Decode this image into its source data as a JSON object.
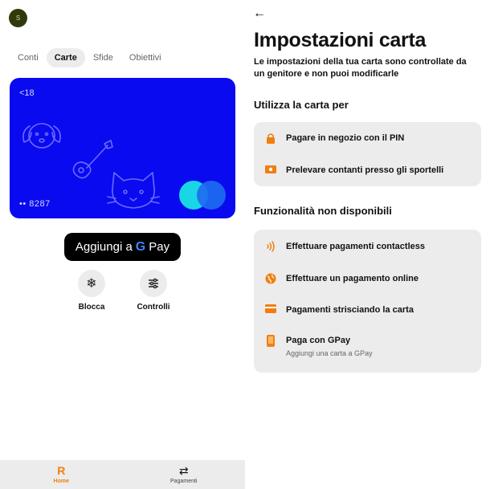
{
  "left": {
    "avatar_initial": "S",
    "tabs": [
      {
        "label": "Conti"
      },
      {
        "label": "Carte"
      },
      {
        "label": "Sfide"
      },
      {
        "label": "Obiettivi"
      }
    ],
    "card": {
      "age_badge": "<18",
      "card_number": "•• 8287"
    },
    "gpay": {
      "prefix": "Aggiungi a",
      "g": "G",
      "pay": "Pay"
    },
    "actions": [
      {
        "label": "Blocca",
        "icon": "snowflake-icon"
      },
      {
        "label": "Controlli",
        "icon": "sliders-icon"
      }
    ],
    "nav": [
      {
        "label": "Home",
        "icon": "R"
      },
      {
        "label": "Pagamenti",
        "icon": "⇄"
      }
    ],
    "accent": "#f07f10",
    "card_color": "#0a0af0"
  },
  "right": {
    "title": "Impostazioni carta",
    "subtitle": "Le impostazioni della tua carta sono controllate da un genitore e non puoi modificarle",
    "section1": "Utilizza la carta per",
    "section1_items": [
      {
        "label": "Pagare in negozio con il PIN",
        "icon": "lock-icon"
      },
      {
        "label": "Prelevare contanti presso gli sportelli",
        "icon": "cash-icon"
      }
    ],
    "section2": "Funzionalità non disponibili",
    "section2_items": [
      {
        "label": "Effettuare pagamenti contactless",
        "icon": "contactless-icon"
      },
      {
        "label": "Effettuare un pagamento online",
        "icon": "globe-icon"
      },
      {
        "label": "Pagamenti strisciando la carta",
        "icon": "card-icon"
      },
      {
        "label": "Paga con GPay",
        "icon": "phone-icon",
        "sub": "Aggiungi una carta a GPay"
      }
    ]
  }
}
